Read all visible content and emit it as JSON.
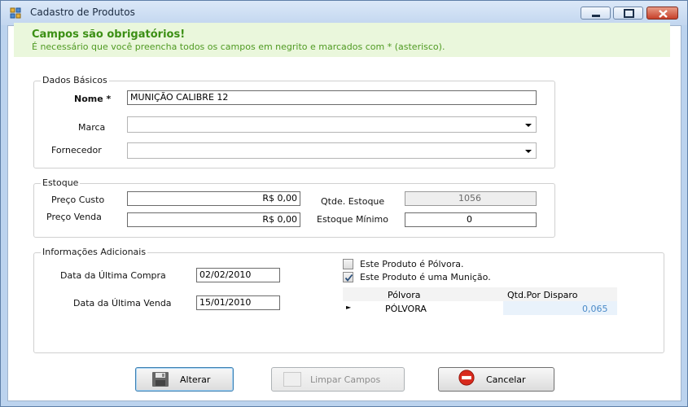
{
  "window": {
    "title": "Cadastro de Produtos",
    "controls": {
      "minimize_icon": "minimize-icon",
      "maximize_icon": "maximize-icon",
      "close_icon": "close-icon"
    }
  },
  "banner": {
    "title": "Campos são obrigatórios!",
    "text": "É necessário que você preencha todos os campos em negrito e marcados com * (asterisco).",
    "background": "#eaf7dc",
    "color": "#3b8f14"
  },
  "dados_basicos": {
    "legend": "Dados Básicos",
    "nome_label": "Nome *",
    "nome_value": "MUNIÇÃO CALIBRE 12",
    "marca_label": "Marca",
    "marca_value": "",
    "fornecedor_label": "Fornecedor",
    "fornecedor_value": ""
  },
  "estoque": {
    "legend": "Estoque",
    "preco_custo_label": "Preço Custo",
    "preco_custo_value": "R$ 0,00",
    "preco_venda_label": "Preço Venda",
    "preco_venda_value": "R$ 0,00",
    "qtde_label": "Qtde. Estoque",
    "qtde_value": "1056",
    "minimo_label": "Estoque Mínimo",
    "minimo_value": "0"
  },
  "adicionais": {
    "legend": "Informações Adicionais",
    "ultima_compra_label": "Data da Última Compra",
    "ultima_compra_value": "02/02/2010",
    "ultima_venda_label": "Data da Última Venda",
    "ultima_venda_value": "15/01/2010",
    "polvora_checkbox_label": "Este Produto é Pólvora.",
    "polvora_checked": false,
    "municao_checkbox_label": "Este Produto é uma Munição.",
    "municao_checked": true,
    "grid": {
      "columns": [
        "Pólvora",
        "Qtd.Por Disparo"
      ],
      "rows": [
        {
          "marker": "►",
          "polvora": "PÓLVORA",
          "qtd": "0,065"
        }
      ]
    }
  },
  "buttons": {
    "alterar": "Alterar",
    "limpar": "Limpar Campos",
    "cancelar": "Cancelar",
    "alterar_icon": "floppy-disk-icon",
    "cancelar_icon": "cancel-icon"
  }
}
